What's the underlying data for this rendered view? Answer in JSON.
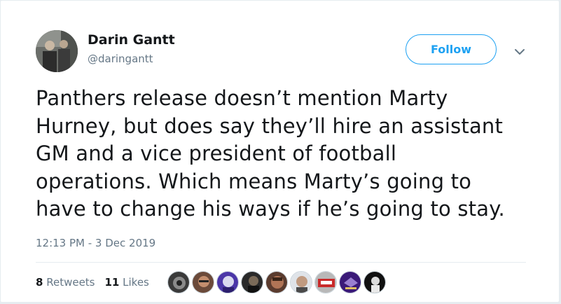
{
  "author": {
    "name": "Darin Gantt",
    "handle": "@daringantt"
  },
  "follow_button": {
    "label": "Follow"
  },
  "tweet": {
    "text_lines": [
      "Panthers release doesn’t mention Marty",
      "Hurney, but does say they’ll hire an assistant",
      "GM and a vice president of football",
      "operations. Which means Marty’s going to",
      "have to change his ways if he’s going to stay."
    ],
    "timestamp": "12:13 PM - 3 Dec 2019"
  },
  "stats": {
    "retweets_count": "8",
    "retweets_label": "Retweets",
    "likes_count": "11",
    "likes_label": "Likes"
  },
  "likers": [
    {
      "name": "liker-1"
    },
    {
      "name": "liker-2"
    },
    {
      "name": "liker-3"
    },
    {
      "name": "liker-4"
    },
    {
      "name": "liker-5"
    },
    {
      "name": "liker-6"
    },
    {
      "name": "liker-7"
    },
    {
      "name": "liker-8"
    },
    {
      "name": "liker-9"
    }
  ],
  "colors": {
    "accent": "#1da1f2",
    "text": "#14171a",
    "muted": "#657786"
  }
}
